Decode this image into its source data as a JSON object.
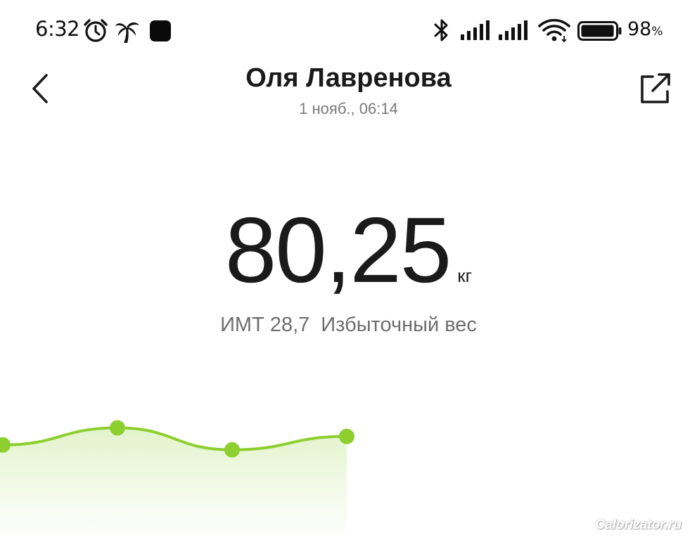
{
  "status_bar": {
    "time": "6:32",
    "battery_percent": "98",
    "battery_percent_sign": "%",
    "battery_level": 0.98,
    "icons": [
      "alarm-icon",
      "palm-tree-icon",
      "app-notification-icon",
      "bluetooth-icon",
      "signal-icon",
      "signal-icon",
      "wifi-icon",
      "battery-icon"
    ]
  },
  "header": {
    "title": "Оля Лавренова",
    "subtitle": "1 нояб., 06:14",
    "back_icon": "chevron-left-icon",
    "share_icon": "share-external-icon"
  },
  "measurement": {
    "weight": "80,25",
    "unit": "кг",
    "bmi_label": "ИМТ 28,7",
    "bmi_category": "Избыточный вес"
  },
  "colors": {
    "accent": "#8ccf2f",
    "fill": "#eef8e1",
    "text": "#1a1a1a",
    "muted": "#7a7a7a"
  },
  "chart_data": {
    "type": "area",
    "x": [
      1,
      2,
      3,
      4
    ],
    "values": [
      79.9,
      80.6,
      79.7,
      80.25
    ],
    "title": "",
    "xlabel": "",
    "ylabel": "",
    "ylim": [
      76,
      82
    ],
    "grid": false
  },
  "watermark": "Calorizator.ru"
}
